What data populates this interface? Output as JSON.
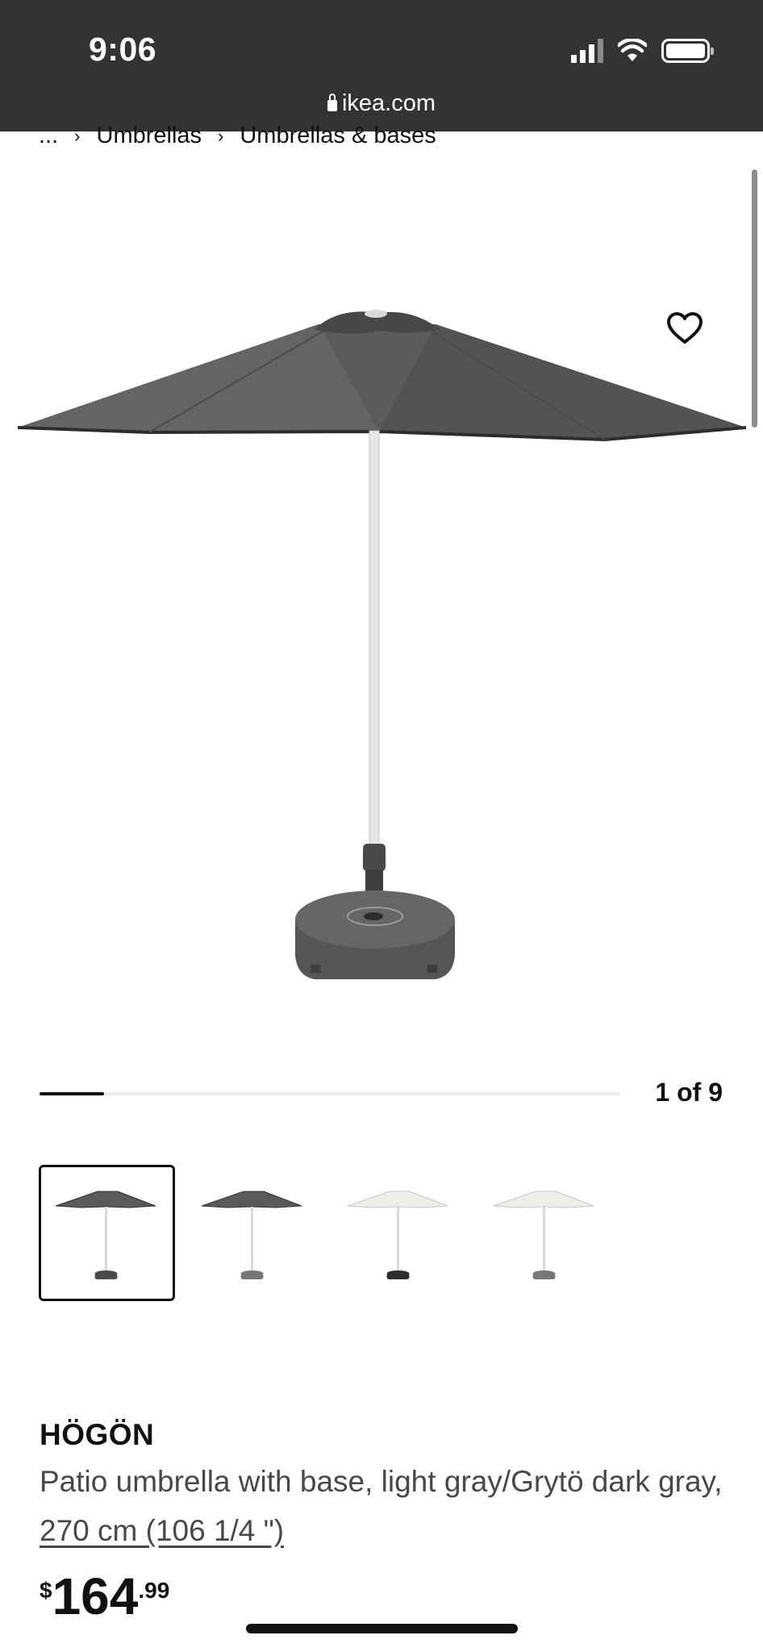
{
  "status_bar": {
    "time": "9:06",
    "icons": [
      "signal-icon",
      "wifi-icon",
      "battery-icon"
    ]
  },
  "url_bar": {
    "domain": "ikea.com",
    "icon": "lock-icon"
  },
  "breadcrumb": {
    "items": [
      "...",
      "Umbrellas",
      "Umbrellas & bases"
    ],
    "separator_icon": "chevron-right-icon"
  },
  "gallery": {
    "counter": "1 of 9",
    "progress_fraction": 0.111,
    "favorite_icon": "heart-icon",
    "thumbnails": [
      {
        "canopy_color": "#5a5a5a",
        "base_color": "#4a4a4a",
        "active": true
      },
      {
        "canopy_color": "#5a5a5a",
        "base_color": "#777777",
        "active": false
      },
      {
        "canopy_color": "#f0eeea",
        "base_color": "#2e2e2e",
        "active": false
      },
      {
        "canopy_color": "#f0eeea",
        "base_color": "#777777",
        "active": false
      }
    ]
  },
  "product": {
    "name": "HÖGÖN",
    "description": "Patio umbrella with base, light gray/Grytö dark gray, ",
    "size": "270 cm (106 1/4 \")",
    "price": {
      "currency": "$",
      "integer": "164",
      "decimal": ".99"
    }
  },
  "colors": {
    "topbar": "#333333",
    "canopy": "#5b5b5b",
    "text": "#111111",
    "muted_text": "#484848"
  }
}
